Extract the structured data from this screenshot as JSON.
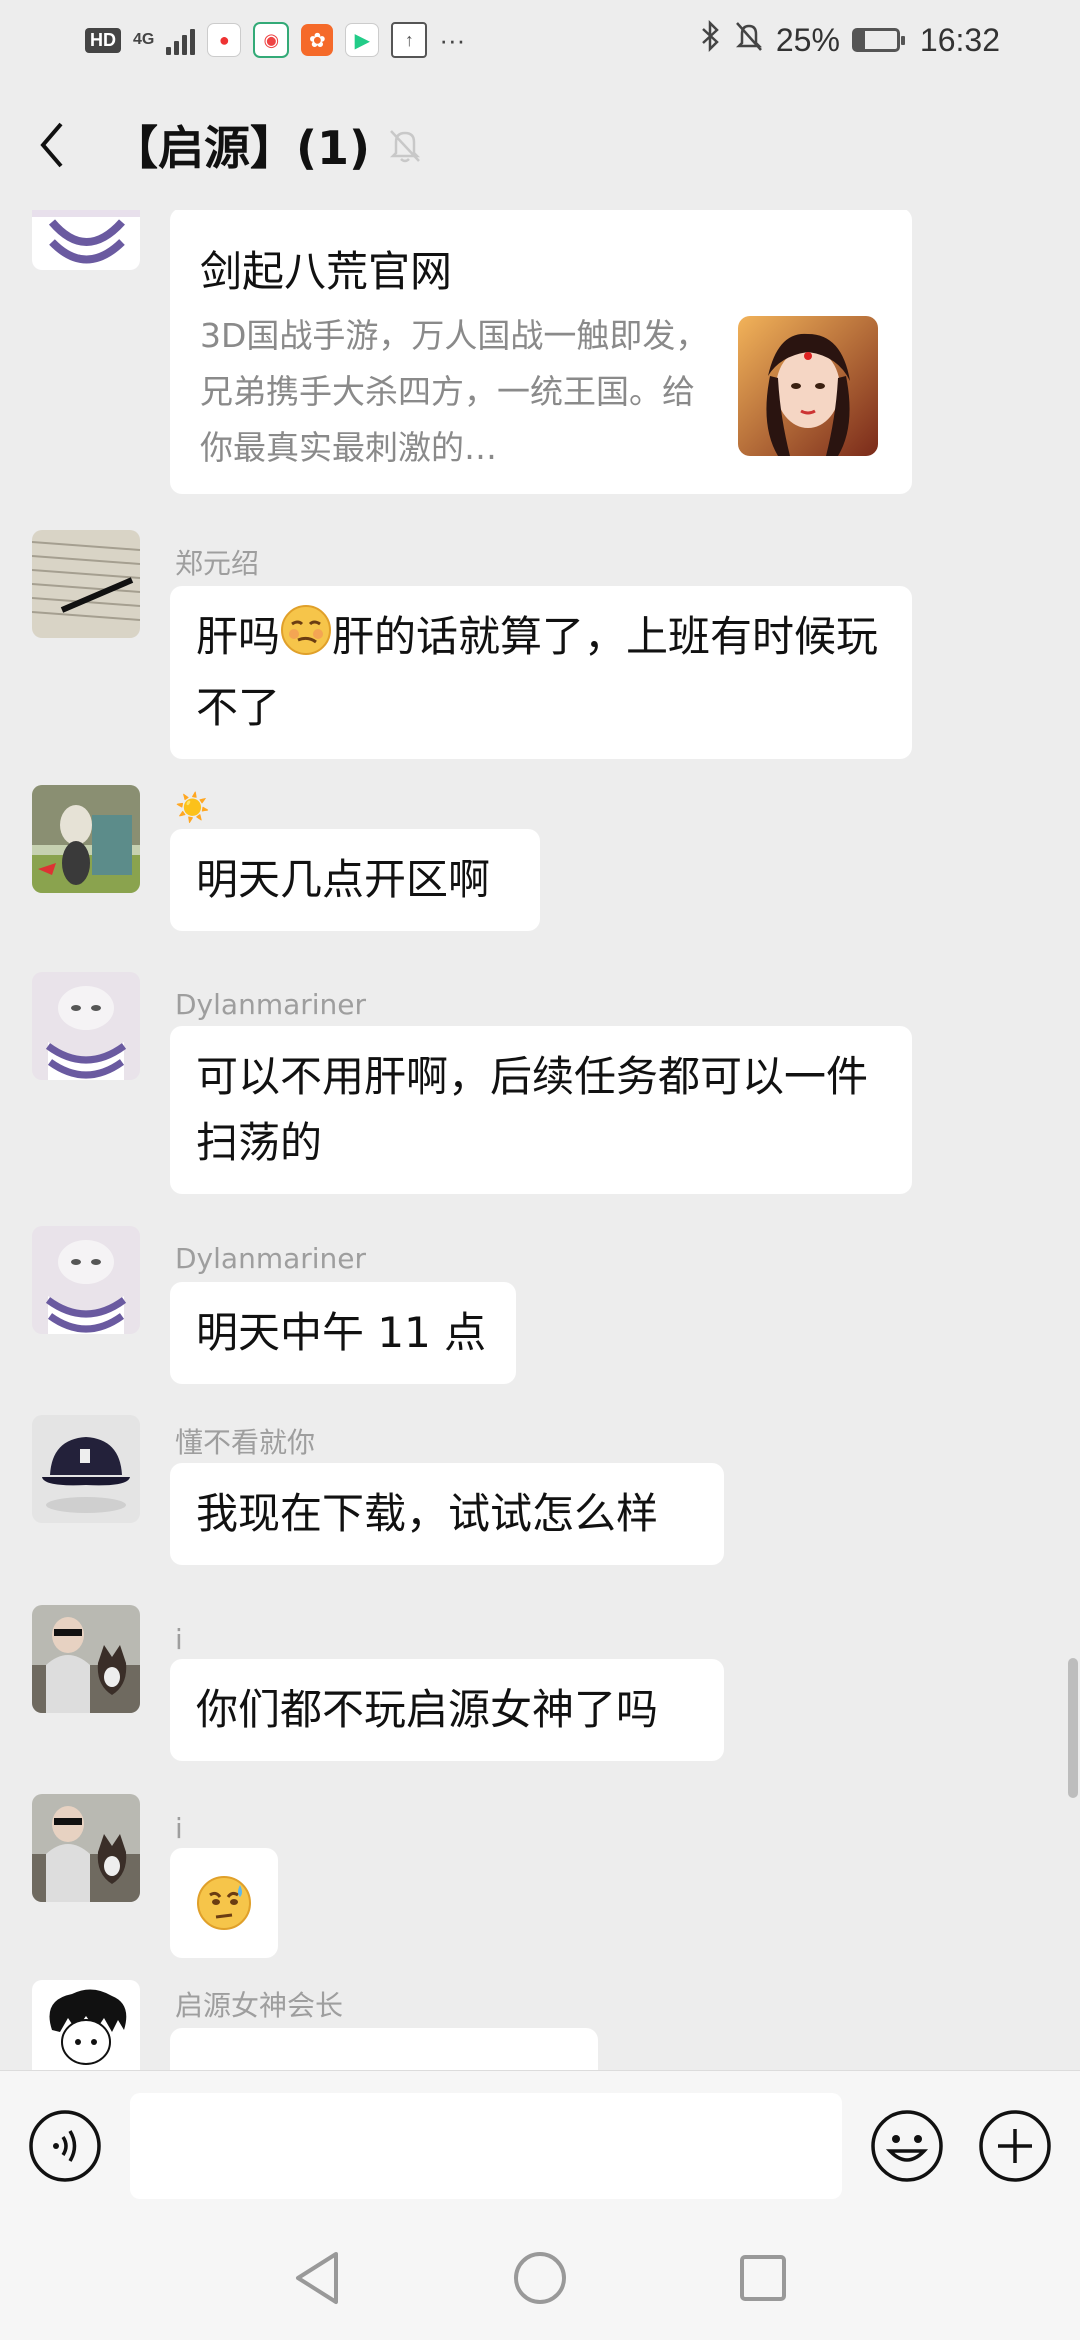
{
  "status_bar": {
    "hd_badge": "HD",
    "network": "4G",
    "battery_percent": "25%",
    "battery_level": 0.25,
    "time": "16:32",
    "more": "···"
  },
  "header": {
    "title": "【启源】(1)"
  },
  "messages": [
    {
      "type": "link",
      "title": "剑起八荒官网",
      "description": "3D国战手游，万人国战一触即发，兄弟携手大杀四方，一统王国。给你最真实最刺激的…"
    },
    {
      "sender": "郑元绍",
      "text_before": "肝吗",
      "emoji": "smirk-emoji",
      "text_after": "肝的话就算了，上班有时候玩不了"
    },
    {
      "sender": "☀️",
      "text": "明天几点开区啊"
    },
    {
      "sender": "Dylanmariner",
      "text": "可以不用肝啊，后续任务都可以一件扫荡的"
    },
    {
      "sender": "Dylanmariner",
      "text": "明天中午 11 点"
    },
    {
      "sender": "懂不看就你",
      "text": "我现在下载，试试怎么样"
    },
    {
      "sender": "i",
      "text": "你们都不玩启源女神了吗"
    },
    {
      "sender": "i",
      "emoji": "sweat-emoji"
    },
    {
      "sender": "启源女神会长"
    }
  ],
  "input": {
    "value": "",
    "placeholder": ""
  },
  "colors": {
    "background": "#ededed",
    "bubble": "#ffffff",
    "sender_text": "#9e9e9e",
    "input_bar": "#f6f6f6"
  }
}
